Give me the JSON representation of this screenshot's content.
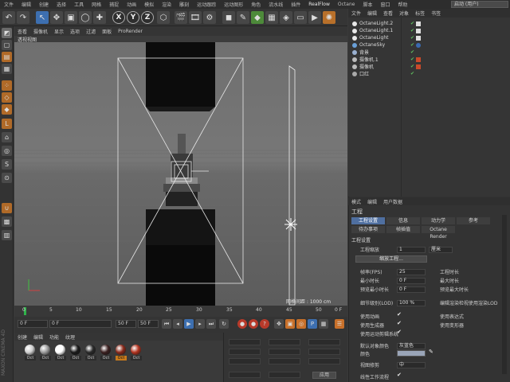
{
  "menubar": {
    "items": [
      "文件",
      "编辑",
      "创建",
      "选择",
      "工具",
      "网格",
      "捕捉",
      "动画",
      "模拟",
      "渲染",
      "雕刻",
      "运动跟踪",
      "运动图形",
      "角色",
      "流水线",
      "插件",
      "RealFlow",
      "Octane",
      "脚本",
      "窗口",
      "帮助"
    ],
    "layout_label": "启动 (用户)"
  },
  "toolbar": {
    "axis_x": "X",
    "axis_y": "Y",
    "axis_z": "Z"
  },
  "viewport": {
    "menu": [
      "查看",
      "摄像机",
      "显示",
      "选项",
      "过滤",
      "面板",
      "ProRender"
    ],
    "title": "透视视图",
    "grid_label": "网格间距 : 1000 cm"
  },
  "timeline": {
    "ticks": [
      "0",
      "5",
      "10",
      "15",
      "20",
      "25",
      "30",
      "35",
      "40",
      "45",
      "50"
    ],
    "end_label": "0 F"
  },
  "transport": {
    "start_field": "0 F",
    "current_field": "0 F",
    "end_field": "50 F",
    "end_field2": "50 F"
  },
  "material_manager": {
    "menu": [
      "创建",
      "编辑",
      "功能",
      "纹理"
    ],
    "materials": [
      {
        "label": "Oct",
        "color": "#cfcfcf",
        "selected": false
      },
      {
        "label": "Oct",
        "color": "#9a9a9a",
        "selected": false
      },
      {
        "label": "Oct",
        "color": "#ffffff",
        "selected": false
      },
      {
        "label": "Oct",
        "color": "#1a1a1a",
        "selected": false
      },
      {
        "label": "Oct",
        "color": "#2a2a2a",
        "selected": false
      },
      {
        "label": "Oct",
        "color": "#3a2020",
        "selected": false
      },
      {
        "label": "Oct",
        "color": "#8a2a1a",
        "selected": true
      },
      {
        "label": "Oct",
        "color": "#b2331f",
        "selected": false
      }
    ]
  },
  "coord_panel": {
    "apply_label": "应用"
  },
  "object_manager": {
    "menu": [
      "文件",
      "编辑",
      "查看",
      "对象",
      "标签",
      "书签"
    ],
    "rows": [
      {
        "name": "OctaneLight.2",
        "icon_color": "#e8e8e8"
      },
      {
        "name": "OctaneLight.1",
        "icon_color": "#e8e8e8"
      },
      {
        "name": "OctaneLight",
        "icon_color": "#e8e8e8"
      },
      {
        "name": "OctaneSky",
        "icon_color": "#6aa0d8"
      },
      {
        "name": "背景",
        "icon_color": "#9ab0d0"
      },
      {
        "name": "摄像机.1",
        "icon_color": "#bbbbbb"
      },
      {
        "name": "摄像机",
        "icon_color": "#bbbbbb"
      },
      {
        "name": "口红",
        "icon_color": "#aaaaaa"
      }
    ]
  },
  "attribute_manager": {
    "menu": [
      "模式",
      "编辑",
      "用户数据"
    ],
    "title": "工程",
    "tabs_row1": [
      "工程设置",
      "信息",
      "动力学",
      "参考"
    ],
    "tabs_row2": [
      "待办事项",
      "帧插值",
      "Octane Render"
    ],
    "section": "工程设置",
    "scale_label": "工程缩放",
    "scale_value": "1",
    "scale_unit": "厘米",
    "scale_button": "缩放工程...",
    "fps_label": "帧率(FPS)",
    "fps_value": "25",
    "project_time_label": "工程时长",
    "min_time_label": "最小时长",
    "min_time_value": "0 F",
    "max_time_label": "最大时长",
    "preview_min_label": "预览最小时长",
    "preview_min_value": "0 F",
    "preview_max_label": "预览最大时长",
    "lod_label": "细节级别(LOD)",
    "lod_value": "100 %",
    "lod_render_label": "编辑渲染检视使用渲染LOD",
    "use_anim_label": "使用动画",
    "use_expr_label": "使用表达式",
    "use_gen_label": "使用生成器",
    "use_deform_label": "使用变形器",
    "use_motion_label": "使用运动剪辑系统",
    "default_color_label": "默认对象颜色",
    "default_color_value": "灰蓝色",
    "color_label": "颜色",
    "view_clip_label": "视图修剪",
    "view_clip_value": "中",
    "linear_label": "线性工作流程"
  }
}
